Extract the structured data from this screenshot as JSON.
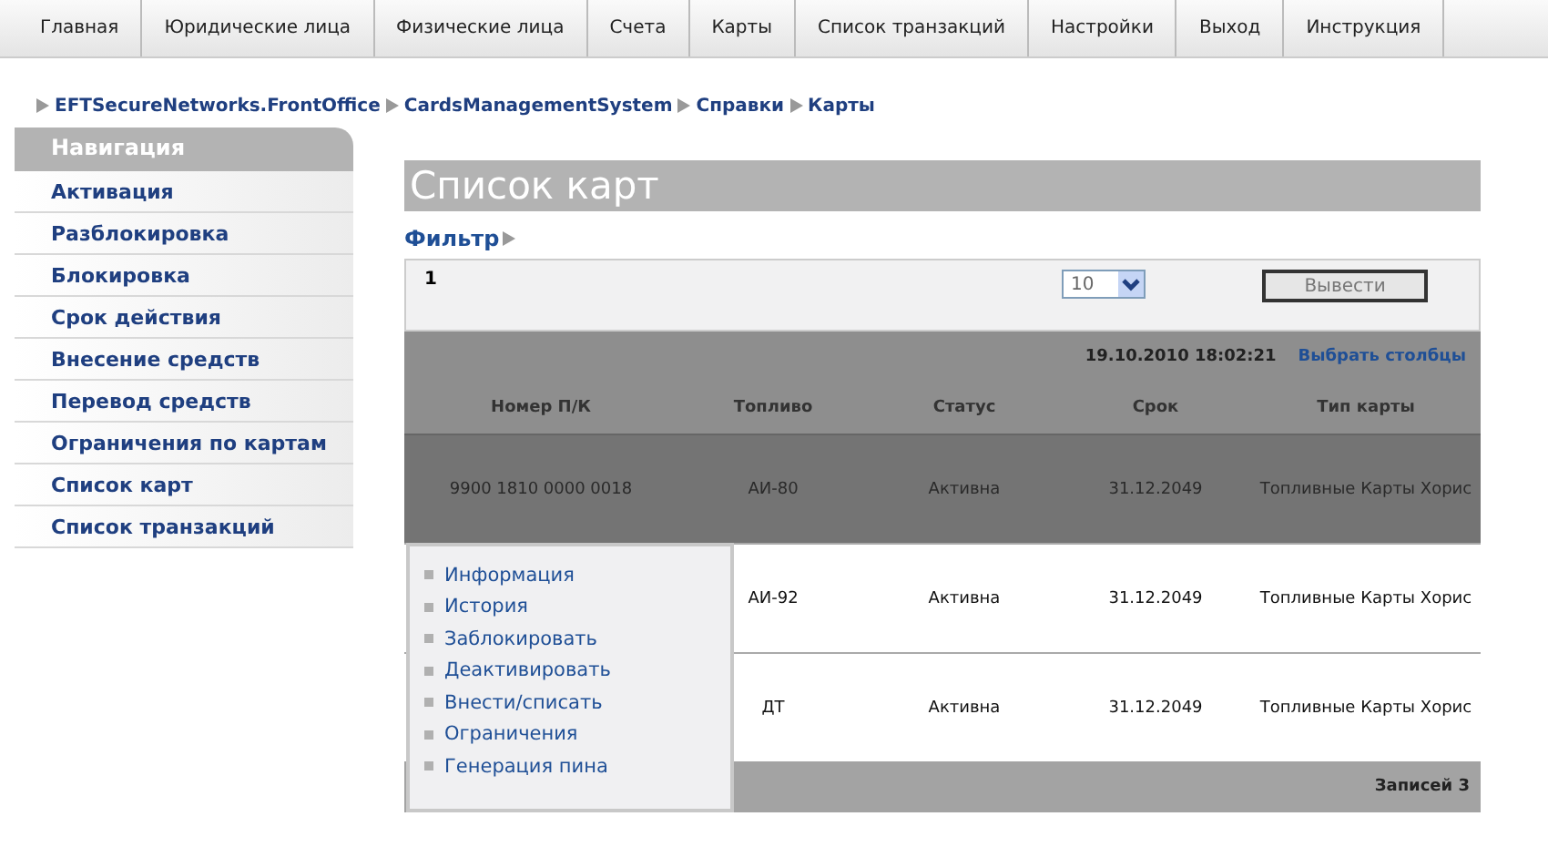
{
  "top_nav": [
    {
      "label": "Главная",
      "selected": false
    },
    {
      "label": "Юридические лица",
      "selected": false
    },
    {
      "label": "Физические лица",
      "selected": false
    },
    {
      "label": "Счета",
      "selected": false
    },
    {
      "label": "Карты",
      "selected": false
    },
    {
      "label": "Список транзакций",
      "selected": false
    },
    {
      "label": "Настройки",
      "selected": false
    },
    {
      "label": "Выход",
      "selected": false
    },
    {
      "label": "Инструкция",
      "selected": false
    }
  ],
  "breadcrumb": [
    "EFTSecureNetworks.FrontOffice",
    "CardsManagementSystem",
    "Справки",
    "Карты"
  ],
  "sidebar": {
    "title": "Навигация",
    "items": [
      {
        "label": "Активация",
        "selected": false
      },
      {
        "label": "Разблокировка",
        "selected": false
      },
      {
        "label": "Блокировка",
        "selected": false
      },
      {
        "label": "Срок действия",
        "selected": false
      },
      {
        "label": "Внесение средств",
        "selected": false
      },
      {
        "label": "Перевод средств",
        "selected": false
      },
      {
        "label": "Ограничения по картам",
        "selected": false
      },
      {
        "label": "Список карт",
        "selected": false
      },
      {
        "label": "Список транзакций",
        "selected": false
      }
    ]
  },
  "page_title": "Список карт",
  "filter_link": "Фильтр",
  "pager": {
    "page": "1",
    "page_size": "10",
    "button": "Вывести"
  },
  "info_bar": {
    "timestamp": "19.10.2010 18:02:21",
    "link": "Выбрать столбцы"
  },
  "table": {
    "columns": [
      "Номер П/К",
      "Топливо",
      "Статус",
      "Срок",
      "Тип карты"
    ],
    "rows": [
      {
        "selected": true,
        "cells": [
          "9900 1810 0000 0018",
          "АИ-80",
          "Активна",
          "31.12.2049",
          "Топливные Карты Хорис"
        ]
      },
      {
        "selected": false,
        "cells": [
          "",
          "АИ-92",
          "Активна",
          "31.12.2049",
          "Топливные Карты Хорис"
        ]
      },
      {
        "selected": false,
        "cells": [
          "",
          "ДТ",
          "Активна",
          "31.12.2049",
          "Топливные Карты Хорис"
        ]
      }
    ],
    "footer": "Записей 3"
  },
  "context_menu": [
    "Информация",
    "История",
    "Заблокировать",
    "Деактивировать",
    "Внести/списать",
    "Ограничения",
    "Генерация пина"
  ]
}
